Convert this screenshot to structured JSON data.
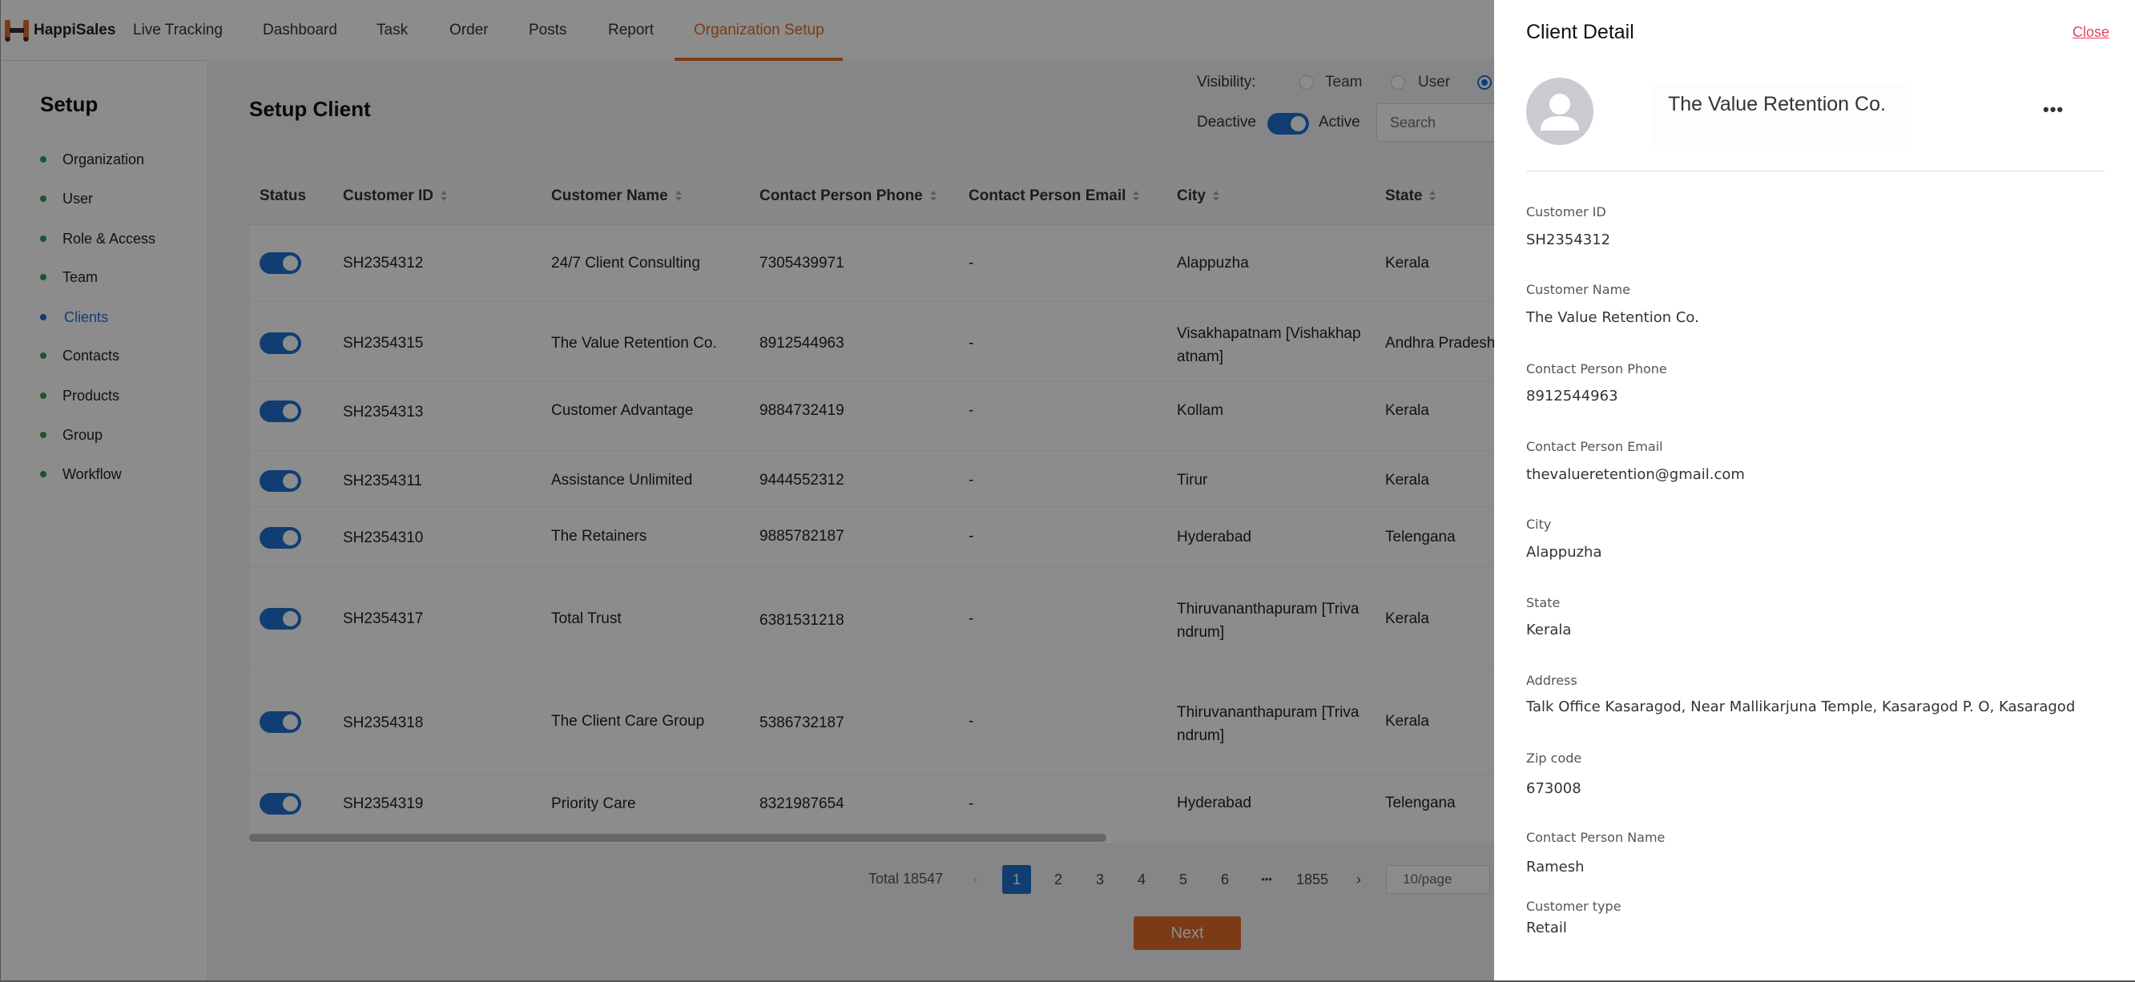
{
  "app": {
    "brand": "HappiSales"
  },
  "nav": {
    "items": [
      {
        "label": "Live Tracking"
      },
      {
        "label": "Dashboard"
      },
      {
        "label": "Task"
      },
      {
        "label": "Order"
      },
      {
        "label": "Posts"
      },
      {
        "label": "Report"
      },
      {
        "label": "Organization Setup"
      }
    ],
    "active_index": 6
  },
  "sidebar": {
    "title": "Setup",
    "items": [
      {
        "label": "Organization"
      },
      {
        "label": "User"
      },
      {
        "label": "Role & Access"
      },
      {
        "label": "Team"
      },
      {
        "label": "Clients"
      },
      {
        "label": "Contacts"
      },
      {
        "label": "Products"
      },
      {
        "label": "Group"
      },
      {
        "label": "Workflow"
      }
    ],
    "active_index": 4
  },
  "main": {
    "title": "Setup Client",
    "visibility_label": "Visibility:",
    "visibility_options": [
      "Team",
      "User"
    ],
    "deactive_label": "Deactive",
    "active_label": "Active",
    "search_placeholder": "Search"
  },
  "table": {
    "columns": [
      "Status",
      "Customer ID",
      "Customer Name",
      "Contact Person Phone",
      "Contact Person Email",
      "City",
      "State"
    ],
    "rows": [
      {
        "id": "SH2354312",
        "name": "24/7 Client Consulting",
        "phone": "7305439971",
        "email": "-",
        "city": "Alappuzha",
        "state": "Kerala"
      },
      {
        "id": "SH2354315",
        "name": "The Value Retention Co.",
        "phone": "8912544963",
        "email": "-",
        "city": "Visakhapatnam [Vishakhap atnam]",
        "state": "Andhra Pradesh"
      },
      {
        "id": "SH2354313",
        "name": "Customer Advantage",
        "phone": "9884732419",
        "email": "-",
        "city": "Kollam",
        "state": "Kerala"
      },
      {
        "id": "SH2354311",
        "name": "Assistance Unlimited",
        "phone": "9444552312",
        "email": "-",
        "city": "Tirur",
        "state": "Kerala"
      },
      {
        "id": "SH2354310",
        "name": "The Retainers",
        "phone": "9885782187",
        "email": "-",
        "city": "Hyderabad",
        "state": "Telengana"
      },
      {
        "id": "SH2354317",
        "name": "Total Trust",
        "phone": "6381531218",
        "email": "-",
        "city": "Thiruvananthapuram [Triva ndrum]",
        "state": "Kerala"
      },
      {
        "id": "SH2354318",
        "name": "The Client Care Group",
        "phone": "5386732187",
        "email": "-",
        "city": "Thiruvananthapuram [Triva ndrum]",
        "state": "Kerala"
      },
      {
        "id": "SH2354319",
        "name": "Priority Care",
        "phone": "8321987654",
        "email": "-",
        "city": "Hyderabad",
        "state": "Telengana"
      }
    ]
  },
  "pagination": {
    "total": "Total 18547",
    "pages": [
      "1",
      "2",
      "3",
      "4",
      "5",
      "6",
      "•••",
      "1855"
    ],
    "current": "1",
    "prev": "‹",
    "next": "›",
    "page_size": "10/page",
    "next_button": "Next"
  },
  "drawer": {
    "title": "Client Detail",
    "close": "Close",
    "client_name": "The Value Retention Co.",
    "more": "•••",
    "fields": [
      {
        "label": "Customer ID",
        "value": "SH2354312"
      },
      {
        "label": "Customer Name",
        "value": "The Value Retention Co."
      },
      {
        "label": "Contact Person Phone",
        "value": "8912544963"
      },
      {
        "label": "Contact Person Email",
        "value": "thevalueretention@gmail.com"
      },
      {
        "label": "City",
        "value": "Alappuzha"
      },
      {
        "label": "State",
        "value": "Kerala"
      },
      {
        "label": "Address",
        "value": "Talk Office Kasaragod, Near Mallikarjuna Temple, Kasaragod P. O, Kasaragod"
      },
      {
        "label": "Zip code",
        "value": "673008"
      },
      {
        "label": "Contact Person Name",
        "value": "Ramesh"
      },
      {
        "label": "Customer type",
        "value": "Retail"
      }
    ]
  },
  "colors": {
    "accent": "#e06c2a",
    "primary": "#1f6fd1",
    "close": "#e8415e"
  }
}
